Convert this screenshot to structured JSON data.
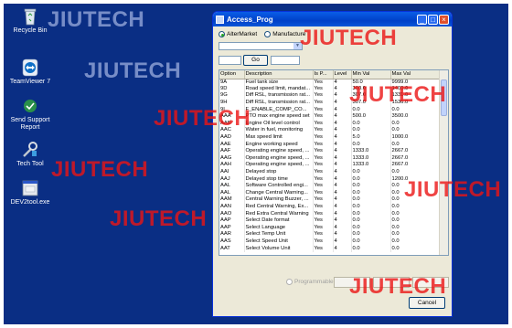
{
  "watermark": "JIUTECH",
  "desktop": {
    "icons": [
      {
        "label": "Recycle Bin",
        "icon": "recycle-bin-icon"
      },
      {
        "label": "TeamViewer 7",
        "icon": "teamviewer-icon"
      },
      {
        "label": "Send Support Report",
        "icon": "support-report-icon"
      },
      {
        "label": "Tech Tool",
        "icon": "tech-tool-icon"
      },
      {
        "label": "DEV2tool.exe",
        "icon": "exe-icon"
      }
    ]
  },
  "window": {
    "title": "Access_Prog",
    "controls": {
      "minimize": "_",
      "maximize": "□",
      "close": "×"
    },
    "radio": {
      "aftermarket": "AlterMarket",
      "manufacture": "Manufacture",
      "selected": "aftermarket"
    },
    "go_label": "Go",
    "columns": [
      "Option",
      "Description",
      "Is P...",
      "Level",
      "Min Val",
      "Max Val"
    ],
    "rows": [
      [
        "9A",
        "Fuel tank size",
        "Yes",
        "4",
        "50.0",
        "9999.0"
      ],
      [
        "9D",
        "Road speed limit, mandat...",
        "Yes",
        "4",
        "300.0",
        "1400.0"
      ],
      [
        "9G",
        "Diff RSL, transmission rat...",
        "Yes",
        "4",
        "307.0",
        "1331.0"
      ],
      [
        "9H",
        "Diff RSL, transmission rat...",
        "Yes",
        "4",
        "307.0",
        "1536.0"
      ],
      [
        "9I",
        "F_ENABLE_COMP_CO...",
        "Yes",
        "4",
        "0.0",
        "0.0"
      ],
      [
        "AAA",
        "PTO max engine speed set",
        "Yes",
        "4",
        "500.0",
        "3500.0"
      ],
      [
        "AAB",
        "Engine Oil level control",
        "Yes",
        "4",
        "0.0",
        "0.0"
      ],
      [
        "AAC",
        "Water in fuel, monitoring",
        "Yes",
        "4",
        "0.0",
        "0.0"
      ],
      [
        "AAD",
        "Max speed limit",
        "Yes",
        "4",
        "5.0",
        "1000.0"
      ],
      [
        "AAE",
        "Engine working speed",
        "Yes",
        "4",
        "0.0",
        "0.0"
      ],
      [
        "AAF",
        "Operating engine speed, ...",
        "Yes",
        "4",
        "1333.0",
        "2667.0"
      ],
      [
        "AAG",
        "Operating engine speed, ...",
        "Yes",
        "4",
        "1333.0",
        "2667.0"
      ],
      [
        "AAH",
        "Operating engine speed, ...",
        "Yes",
        "4",
        "1333.0",
        "2667.0"
      ],
      [
        "AAI",
        "Delayed stop",
        "Yes",
        "4",
        "0.0",
        "0.0"
      ],
      [
        "AAJ",
        "Delayed stop time",
        "Yes",
        "4",
        "0.0",
        "1200.0"
      ],
      [
        "AAL",
        "Software Controlled engi...",
        "Yes",
        "4",
        "0.0",
        "0.0"
      ],
      [
        "AAL",
        "Change Central Warning...",
        "Yes",
        "4",
        "0.0",
        "0.0"
      ],
      [
        "AAM",
        "Central Warning Buzzer, ...",
        "Yes",
        "4",
        "0.0",
        "0.0"
      ],
      [
        "AAN",
        "Red Central Warning, Ex...",
        "Yes",
        "4",
        "0.0",
        "0.0"
      ],
      [
        "AAO",
        "Red Extra Central Warning",
        "Yes",
        "4",
        "0.0",
        "0.0"
      ],
      [
        "AAP",
        "Select Date format",
        "Yes",
        "4",
        "0.0",
        "0.0"
      ],
      [
        "AAP",
        "Select Language",
        "Yes",
        "4",
        "0.0",
        "0.0"
      ],
      [
        "AAR",
        "Select Temp Unit",
        "Yes",
        "4",
        "0.0",
        "0.0"
      ],
      [
        "AAS",
        "Select Speed Unit",
        "Yes",
        "4",
        "0.0",
        "0.0"
      ],
      [
        "AAT",
        "Select Volume Unit",
        "Yes",
        "4",
        "0.0",
        "0.0"
      ]
    ],
    "programmable_label": "Programmable",
    "cancel_label": "Cancel"
  }
}
